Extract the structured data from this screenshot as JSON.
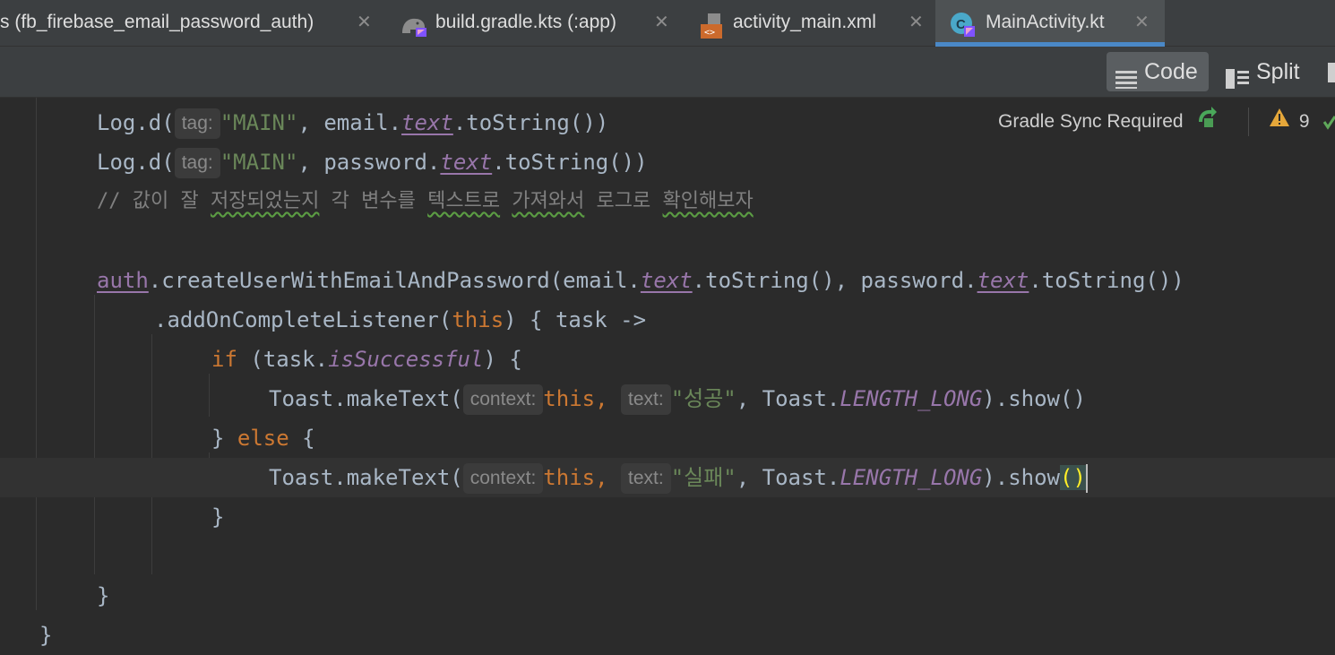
{
  "tabs": [
    {
      "label": "s (fb_firebase_email_password_auth)",
      "icon": "gradle-file-icon",
      "active": false
    },
    {
      "label": "build.gradle.kts (:app)",
      "icon": "gradle-elephant-icon",
      "active": false
    },
    {
      "label": "activity_main.xml",
      "icon": "xml-layout-icon",
      "active": false
    },
    {
      "label": "MainActivity.kt",
      "icon": "kotlin-class-icon",
      "active": true
    }
  ],
  "tab_close_glyph": "✕",
  "toolbar": {
    "code_label": "Code",
    "split_label": "Split"
  },
  "status": {
    "gradle_sync": "Gradle Sync Required",
    "warnings_count": "9"
  },
  "code": {
    "l1": {
      "a": "Log.d(",
      "hint": "tag:",
      "str": "\"MAIN\"",
      "b": ", email.",
      "prop": "text",
      "c": ".toString())"
    },
    "l2": {
      "a": "Log.d(",
      "hint": "tag:",
      "str": "\"MAIN\"",
      "b": ", password.",
      "prop": "text",
      "c": ".toString())"
    },
    "l3": {
      "pre": "// 값이 잘 ",
      "w1": "저장되었는지",
      "mid": " 각 변수를 ",
      "w2": "텍스트로",
      "sp": " ",
      "w3": "가져와서",
      "mid2": " 로그로 ",
      "w4": "확인해보자"
    },
    "l5": {
      "auth": "auth",
      "a": ".createUserWithEmailAndPassword(email.",
      "prop1": "text",
      "b": ".toString(), password.",
      "prop2": "text",
      "c": ".toString())"
    },
    "l6": {
      "a": ".addOnCompleteListener(",
      "kw": "this",
      "b": ") { task ->"
    },
    "l7": {
      "kw": "if",
      "a": " (task.",
      "prop": "isSuccessful",
      "b": ") {"
    },
    "l8": {
      "a": "Toast.makeText(",
      "hint1": "context:",
      "kw": "this",
      "comma": ",",
      "hint2": "text:",
      "str": "\"성공\"",
      "b": ", Toast.",
      "const": "LENGTH_LONG",
      "c": ").show()"
    },
    "l9": {
      "a": "} ",
      "kw": "else",
      "b": " {"
    },
    "l10": {
      "a": "Toast.makeText(",
      "hint1": "context:",
      "kw": "this",
      "comma": ",",
      "hint2": "text:",
      "str": "\"실패\"",
      "b": ", Toast.",
      "const": "LENGTH_LONG",
      "c": ").show",
      "paren": "()"
    },
    "l11": {
      "a": "}"
    },
    "l13": {
      "a": "}"
    },
    "l14": {
      "a": "}"
    }
  },
  "colors": {
    "keyword": "#cc7832",
    "string": "#6a8759",
    "property": "#9876aa",
    "default": "#a9b7c6",
    "accent": "#4a88c7"
  }
}
